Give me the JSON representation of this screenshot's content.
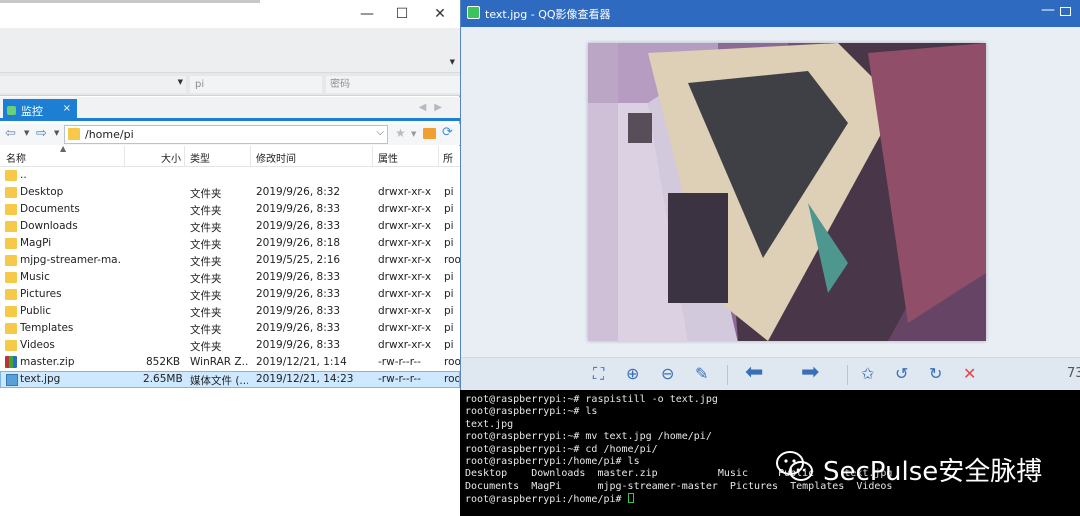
{
  "file_manager": {
    "window_controls": {
      "minimize": "—",
      "maximize": "☐",
      "close": "✕"
    },
    "login": {
      "user": "pi",
      "password_placeholder": "密码"
    },
    "tab": {
      "label": "监控",
      "close": "×"
    },
    "address": {
      "path": "/home/pi"
    },
    "columns": {
      "name": "名称",
      "size": "大小",
      "type": "类型",
      "modified": "修改时间",
      "perms": "属性",
      "owner": "所有"
    },
    "files": [
      {
        "name": "..",
        "size": "",
        "type": "",
        "modified": "",
        "perms": "",
        "owner": "",
        "icon": "folder"
      },
      {
        "name": "Desktop",
        "size": "",
        "type": "文件夹",
        "modified": "2019/9/26, 8:32",
        "perms": "drwxr-xr-x",
        "owner": "pi",
        "icon": "folder"
      },
      {
        "name": "Documents",
        "size": "",
        "type": "文件夹",
        "modified": "2019/9/26, 8:33",
        "perms": "drwxr-xr-x",
        "owner": "pi",
        "icon": "folder"
      },
      {
        "name": "Downloads",
        "size": "",
        "type": "文件夹",
        "modified": "2019/9/26, 8:33",
        "perms": "drwxr-xr-x",
        "owner": "pi",
        "icon": "folder"
      },
      {
        "name": "MagPi",
        "size": "",
        "type": "文件夹",
        "modified": "2019/9/26, 8:18",
        "perms": "drwxr-xr-x",
        "owner": "pi",
        "icon": "folder"
      },
      {
        "name": "mjpg-streamer-ma...",
        "size": "",
        "type": "文件夹",
        "modified": "2019/5/25, 2:16",
        "perms": "drwxr-xr-x",
        "owner": "roo",
        "icon": "folder"
      },
      {
        "name": "Music",
        "size": "",
        "type": "文件夹",
        "modified": "2019/9/26, 8:33",
        "perms": "drwxr-xr-x",
        "owner": "pi",
        "icon": "folder"
      },
      {
        "name": "Pictures",
        "size": "",
        "type": "文件夹",
        "modified": "2019/9/26, 8:33",
        "perms": "drwxr-xr-x",
        "owner": "pi",
        "icon": "folder"
      },
      {
        "name": "Public",
        "size": "",
        "type": "文件夹",
        "modified": "2019/9/26, 8:33",
        "perms": "drwxr-xr-x",
        "owner": "pi",
        "icon": "folder"
      },
      {
        "name": "Templates",
        "size": "",
        "type": "文件夹",
        "modified": "2019/9/26, 8:33",
        "perms": "drwxr-xr-x",
        "owner": "pi",
        "icon": "folder"
      },
      {
        "name": "Videos",
        "size": "",
        "type": "文件夹",
        "modified": "2019/9/26, 8:33",
        "perms": "drwxr-xr-x",
        "owner": "pi",
        "icon": "folder"
      },
      {
        "name": "master.zip",
        "size": "852KB",
        "type": "WinRAR Z...",
        "modified": "2019/12/21, 1:14",
        "perms": "-rw-r--r--",
        "owner": "roo",
        "icon": "zip"
      },
      {
        "name": "text.jpg",
        "size": "2.65MB",
        "type": "媒体文件 (...",
        "modified": "2019/12/21, 14:23",
        "perms": "-rw-r--r--",
        "owner": "roo",
        "icon": "image",
        "selected": true
      }
    ]
  },
  "viewer": {
    "title": "text.jpg - QQ影像查看器",
    "window_controls": {
      "minimize": "—"
    },
    "zoom": "73",
    "toolbar_icons": [
      "fit-screen-icon",
      "zoom-in-icon",
      "zoom-out-icon",
      "brush-icon",
      "prev-arrow-icon",
      "next-arrow-icon",
      "star-icon",
      "rotate-left-icon",
      "rotate-right-icon",
      "delete-icon"
    ]
  },
  "terminal": {
    "lines": [
      "root@raspberrypi:~# raspistill -o text.jpg",
      "root@raspberrypi:~# ls",
      "text.jpg",
      "root@raspberrypi:~# mv text.jpg /home/pi/",
      "root@raspberrypi:~# cd /home/pi/",
      "root@raspberrypi:/home/pi# ls",
      "Desktop    Downloads  master.zip          Music     Public     text.jpg",
      "Documents  MagPi      mjpg-streamer-master  Pictures  Templates  Videos"
    ],
    "prompt": "root@raspberrypi:/home/pi# "
  },
  "watermark": {
    "text": "SecPulse安全脉搏"
  },
  "colors": {
    "accent": "#1d7fd3",
    "viewer_title": "#2e6bc0",
    "selection": "#cde8ff",
    "terminal_bg": "#000000"
  }
}
